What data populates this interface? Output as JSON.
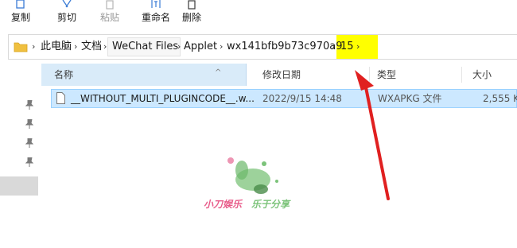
{
  "ribbon": {
    "copy_label": "复制",
    "cut_label": "剪切",
    "paste_label": "粘贴",
    "rename_label": "重命名",
    "delete_label": "删除"
  },
  "address": {
    "crumbs": [
      "此电脑",
      "文档",
      "WeChat Files",
      "Applet",
      "wx141bfb9b73c970a9",
      "15"
    ],
    "highlight_color": "#ffff00"
  },
  "columns": {
    "name": "名称",
    "date": "修改日期",
    "type": "类型",
    "size": "大小"
  },
  "files": [
    {
      "name": "__WITHOUT_MULTI_PLUGINCODE__.w...",
      "date": "2022/9/15 14:48",
      "type": "WXAPKG 文件",
      "size": "2,555 K"
    }
  ],
  "watermark": {
    "left_text": "小刀娱乐",
    "right_text": "乐于分享"
  },
  "colors": {
    "selection": "#cce8ff",
    "sort_header": "#d9ebf9",
    "annotation_arrow": "#e02020"
  }
}
